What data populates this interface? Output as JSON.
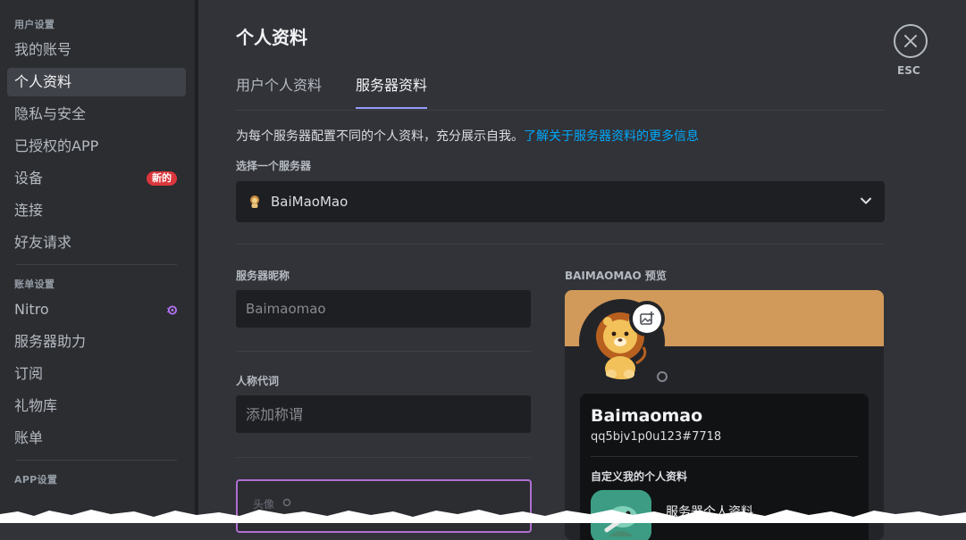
{
  "sidebar": {
    "sections": [
      {
        "header": "用户设置",
        "items": [
          {
            "label": "我的账号"
          },
          {
            "label": "个人资料",
            "active": true
          },
          {
            "label": "隐私与安全"
          },
          {
            "label": "已授权的APP"
          },
          {
            "label": "设备",
            "badge": "新的"
          },
          {
            "label": "连接"
          },
          {
            "label": "好友请求"
          }
        ]
      },
      {
        "header": "账单设置",
        "items": [
          {
            "label": "Nitro",
            "icon": "nitro-icon"
          },
          {
            "label": "服务器助力"
          },
          {
            "label": "订阅"
          },
          {
            "label": "礼物库"
          },
          {
            "label": "账单"
          }
        ]
      },
      {
        "header": "APP设置"
      }
    ]
  },
  "main": {
    "title": "个人资料",
    "tabs": [
      {
        "label": "用户个人资料"
      },
      {
        "label": "服务器资料",
        "active": true
      }
    ],
    "description": "为每个服务器配置不同的个人资料，充分展示自我。",
    "learn_more": "了解关于服务器资料的更多信息",
    "server_select": {
      "label": "选择一个服务器",
      "selected": "BaiMaoMao"
    },
    "nickname": {
      "label": "服务器昵称",
      "value": "",
      "placeholder": "Baimaomao"
    },
    "pronouns": {
      "label": "人称代词",
      "value": "",
      "placeholder": "添加称谓"
    },
    "avatar": {
      "label": "头像"
    }
  },
  "preview": {
    "title": "BAIMAOMAO 预览",
    "banner_color": "#d19a5b",
    "username": "Baimaomao",
    "tag": "qq5bjv1p0u123#7718",
    "custom_title": "自定义我的个人资料",
    "server_profile_label": "服务器个人资料"
  },
  "close": {
    "label": "ESC"
  },
  "colors": {
    "accent": "#949cf7",
    "link": "#00a8fc",
    "badge": "#da373c",
    "avatar_border": "#b06fd1"
  }
}
